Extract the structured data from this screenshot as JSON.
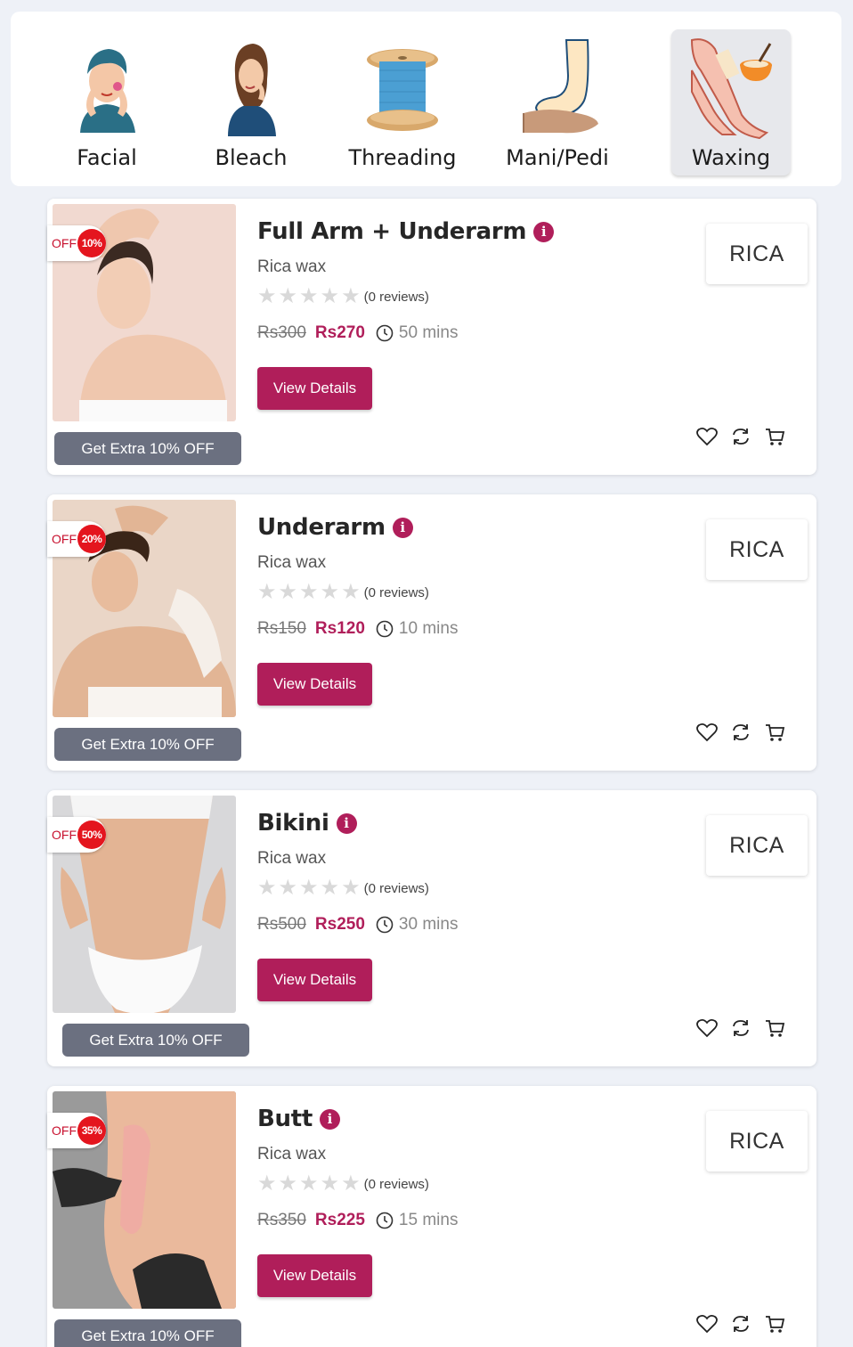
{
  "categories": [
    {
      "label": "Facial",
      "icon": "facial-icon"
    },
    {
      "label": "Bleach",
      "icon": "bleach-icon"
    },
    {
      "label": "Threading",
      "icon": "threading-icon"
    },
    {
      "label": "Mani/Pedi",
      "icon": "mani-pedi-icon"
    },
    {
      "label": "Waxing",
      "icon": "waxing-icon",
      "active": true
    }
  ],
  "products": [
    {
      "title": "Full Arm + Underarm",
      "subtitle": "Rica wax",
      "reviews": "(0 reviews)",
      "rating": 0,
      "old_price": "Rs300",
      "new_price": "Rs270",
      "duration": "50 mins",
      "off_label": "OFF",
      "discount": "10%",
      "extra": "Get Extra 10% OFF",
      "cta": "View Details",
      "brand": "RICA"
    },
    {
      "title": "Underarm",
      "subtitle": "Rica wax",
      "reviews": "(0 reviews)",
      "rating": 0,
      "old_price": "Rs150",
      "new_price": "Rs120",
      "duration": "10 mins",
      "off_label": "OFF",
      "discount": "20%",
      "extra": "Get Extra 10% OFF",
      "cta": "View Details",
      "brand": "RICA"
    },
    {
      "title": "Bikini",
      "subtitle": "Rica wax",
      "reviews": "(0 reviews)",
      "rating": 0,
      "old_price": "Rs500",
      "new_price": "Rs250",
      "duration": "30 mins",
      "off_label": "OFF",
      "discount": "50%",
      "extra": "Get Extra 10% OFF",
      "cta": "View Details",
      "brand": "RICA"
    },
    {
      "title": "Butt",
      "subtitle": "Rica wax",
      "reviews": "(0 reviews)",
      "rating": 0,
      "old_price": "Rs350",
      "new_price": "Rs225",
      "duration": "15 mins",
      "off_label": "OFF",
      "discount": "35%",
      "extra": "Get Extra 10% OFF",
      "cta": "View Details",
      "brand": "RICA"
    }
  ],
  "colors": {
    "accent": "#b01e5a",
    "badge": "#e4151e",
    "extra_button": "#6b7080",
    "background": "#eef1f7"
  }
}
